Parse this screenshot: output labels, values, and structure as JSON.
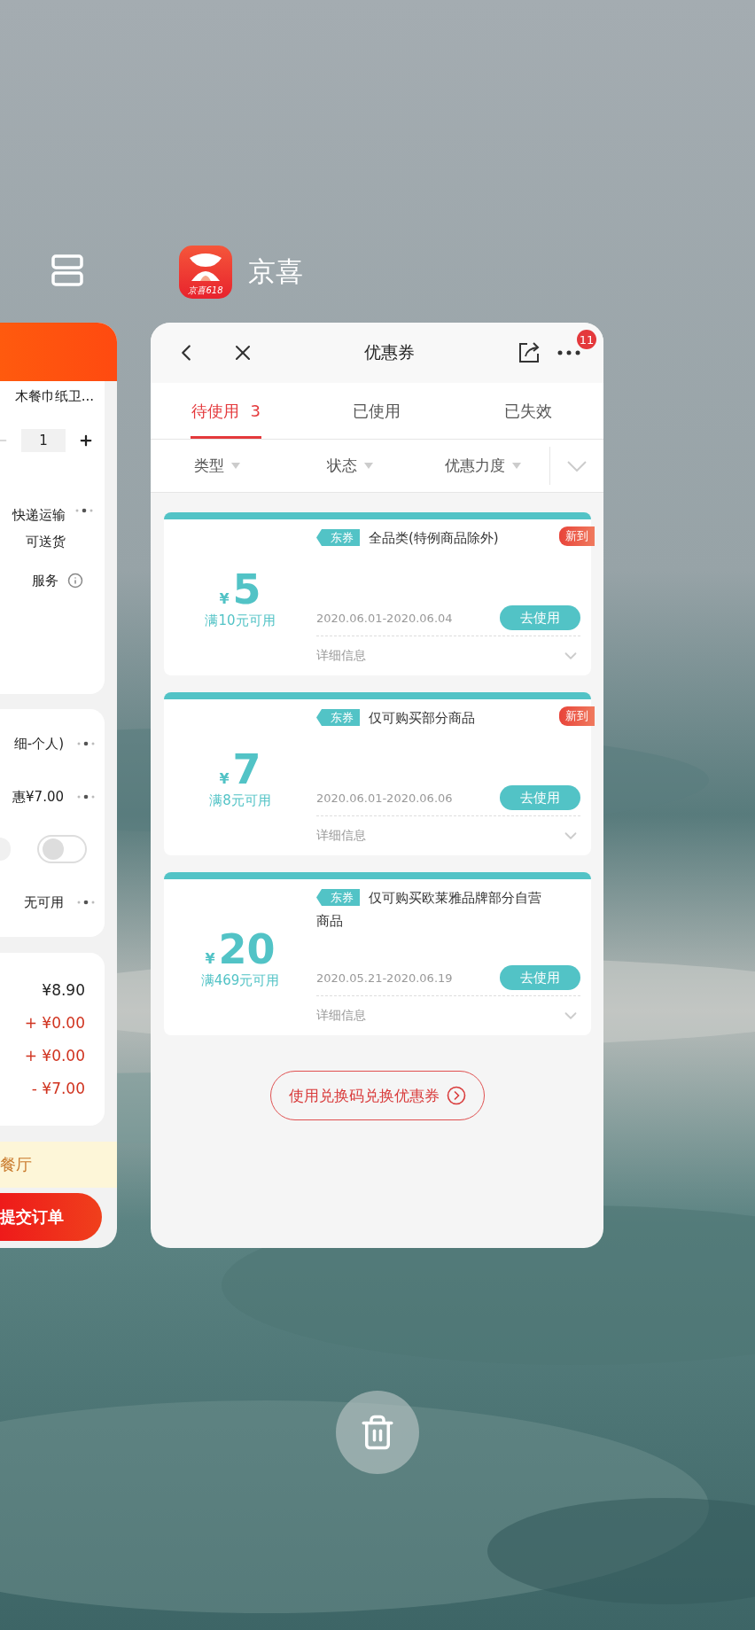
{
  "order_window": {
    "product": "木餐巾纸卫...",
    "quantity": "1",
    "delivery_lines": [
      "快递运输",
      "可送货"
    ],
    "service": "服务",
    "options": [
      {
        "kind": "select",
        "label": "细-个人)"
      },
      {
        "kind": "select",
        "label": "惠¥7.00"
      },
      {
        "kind": "toggle",
        "on": false
      },
      {
        "kind": "select",
        "label": "无可用"
      }
    ],
    "totals": [
      {
        "value": "¥8.90",
        "color": "#222222"
      },
      {
        "value": "+ ¥0.00",
        "color": "#d0331f"
      },
      {
        "value": "+ ¥0.00",
        "color": "#d0331f"
      },
      {
        "value": "- ¥7.00",
        "color": "#d0331f"
      }
    ],
    "notice": "餐厅",
    "submit": "提交订单"
  },
  "app": {
    "name": "京喜",
    "icon_label": "京喜618",
    "window": {
      "title": "优惠券",
      "more_badge": "11",
      "tabs": [
        {
          "label": "待使用",
          "count": "3",
          "selected": true
        },
        {
          "label": "已使用",
          "selected": false
        },
        {
          "label": "已失效",
          "selected": false
        }
      ],
      "filters": [
        {
          "label": "类型"
        },
        {
          "label": "状态"
        },
        {
          "label": "优惠力度"
        }
      ],
      "coupons": [
        {
          "tag": "东券",
          "title": "全品类(特例商品除外)",
          "currency": "¥",
          "amount": "5",
          "condition": "满10元可用",
          "dates": "2020.06.01-2020.06.04",
          "button": "去使用",
          "details": "详细信息",
          "new_label": "新到"
        },
        {
          "tag": "东券",
          "title": "仅可购买部分商品",
          "currency": "¥",
          "amount": "7",
          "condition": "满8元可用",
          "dates": "2020.06.01-2020.06.06",
          "button": "去使用",
          "details": "详细信息",
          "new_label": "新到"
        },
        {
          "tag": "东券",
          "title": "仅可购买欧莱雅品牌部分自营商品",
          "currency": "¥",
          "amount": "20",
          "condition": "满469元可用",
          "dates": "2020.05.21-2020.06.19",
          "button": "去使用",
          "details": "详细信息"
        }
      ],
      "redeem": "使用兑换码兑换优惠券"
    }
  }
}
